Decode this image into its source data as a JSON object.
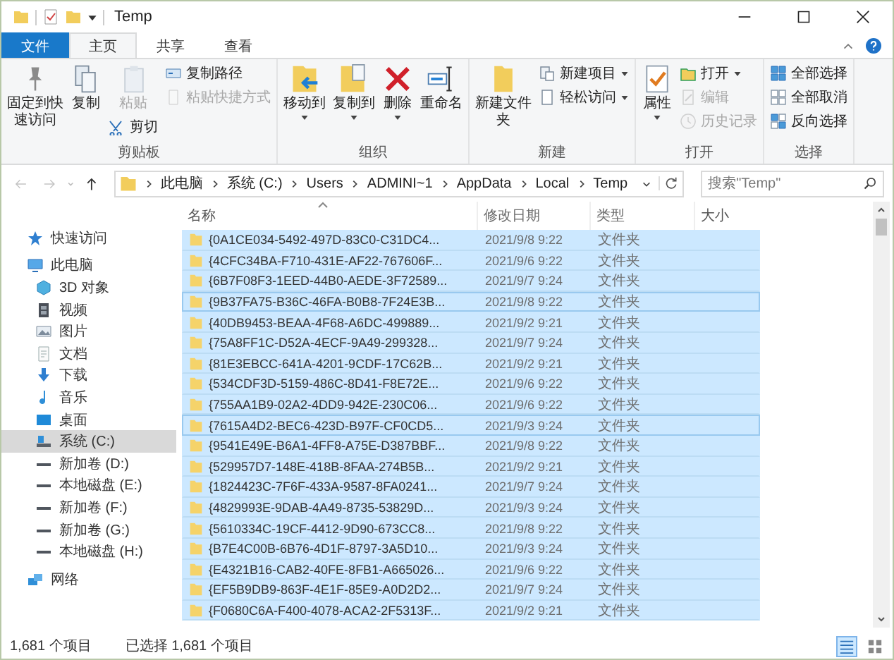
{
  "window": {
    "title": "Temp"
  },
  "tabs": [
    {
      "label": "文件",
      "kind": "file",
      "selected": false
    },
    {
      "label": "主页",
      "kind": "tab",
      "selected": true
    },
    {
      "label": "共享",
      "kind": "tab",
      "selected": false
    },
    {
      "label": "查看",
      "kind": "tab",
      "selected": false
    }
  ],
  "ribbon": {
    "groups": [
      {
        "label": "剪贴板",
        "columns": [
          {
            "items": [
              {
                "label": "固定到快速访问",
                "kind": "large",
                "disabled": false,
                "dropdown": false
              }
            ]
          },
          {
            "items": [
              {
                "label": "复制",
                "kind": "large",
                "disabled": false,
                "dropdown": false
              }
            ]
          },
          {
            "items": [
              {
                "label": "粘贴",
                "kind": "large",
                "disabled": true,
                "dropdown": false
              },
              {
                "label": "剪切",
                "kind": "small",
                "disabled": false,
                "dropdown": false
              }
            ]
          },
          {
            "items": [
              {
                "label": "复制路径",
                "kind": "small",
                "disabled": false,
                "dropdown": false
              },
              {
                "label": "粘贴快捷方式",
                "kind": "small",
                "disabled": true,
                "dropdown": false
              }
            ]
          }
        ]
      },
      {
        "label": "组织",
        "columns": [
          {
            "items": [
              {
                "label": "移动到",
                "kind": "large",
                "disabled": false,
                "dropdown": true
              }
            ]
          },
          {
            "items": [
              {
                "label": "复制到",
                "kind": "large",
                "disabled": false,
                "dropdown": true
              }
            ]
          },
          {
            "items": [
              {
                "label": "删除",
                "kind": "large",
                "disabled": false,
                "dropdown": true
              }
            ]
          },
          {
            "items": [
              {
                "label": "重命名",
                "kind": "large",
                "disabled": false,
                "dropdown": false
              }
            ]
          }
        ]
      },
      {
        "label": "新建",
        "columns": [
          {
            "items": [
              {
                "label": "新建文件夹",
                "kind": "large",
                "disabled": false,
                "dropdown": false
              }
            ]
          },
          {
            "items": [
              {
                "label": "新建项目",
                "kind": "small",
                "disabled": false,
                "dropdown": true
              },
              {
                "label": "轻松访问",
                "kind": "small",
                "disabled": false,
                "dropdown": true
              }
            ]
          }
        ]
      },
      {
        "label": "打开",
        "columns": [
          {
            "items": [
              {
                "label": "属性",
                "kind": "large",
                "disabled": false,
                "dropdown": true
              }
            ]
          },
          {
            "items": [
              {
                "label": "打开",
                "kind": "small",
                "disabled": false,
                "dropdown": true
              },
              {
                "label": "编辑",
                "kind": "small",
                "disabled": true,
                "dropdown": false
              },
              {
                "label": "历史记录",
                "kind": "small",
                "disabled": true,
                "dropdown": false
              }
            ]
          }
        ]
      },
      {
        "label": "选择",
        "columns": [
          {
            "items": [
              {
                "label": "全部选择",
                "kind": "small",
                "disabled": false,
                "dropdown": false
              },
              {
                "label": "全部取消",
                "kind": "small",
                "disabled": false,
                "dropdown": false
              },
              {
                "label": "反向选择",
                "kind": "small",
                "disabled": false,
                "dropdown": false
              }
            ]
          }
        ]
      }
    ]
  },
  "address": {
    "back_disabled": true,
    "forward_disabled": true,
    "crumbs": [
      "此电脑",
      "系统 (C:)",
      "Users",
      "ADMINI~1",
      "AppData",
      "Local",
      "Temp"
    ]
  },
  "search": {
    "placeholder": "搜索\"Temp\""
  },
  "sidebar": {
    "items": [
      {
        "label": "快速访问",
        "kind": "quick",
        "selected": false
      },
      {
        "label": "此电脑",
        "kind": "pc",
        "selected": false,
        "children": [
          {
            "label": "3D 对象",
            "kind": "cube",
            "selected": false
          },
          {
            "label": "视频",
            "kind": "video",
            "selected": false
          },
          {
            "label": "图片",
            "kind": "pictures",
            "selected": false
          },
          {
            "label": "文档",
            "kind": "documents",
            "selected": false
          },
          {
            "label": "下载",
            "kind": "downloads",
            "selected": false
          },
          {
            "label": "音乐",
            "kind": "music",
            "selected": false
          },
          {
            "label": "桌面",
            "kind": "desktop",
            "selected": false
          },
          {
            "label": "系统 (C:)",
            "kind": "system",
            "selected": true
          },
          {
            "label": "新加卷 (D:)",
            "kind": "drive",
            "selected": false
          },
          {
            "label": "本地磁盘 (E:)",
            "kind": "drive",
            "selected": false
          },
          {
            "label": "新加卷 (F:)",
            "kind": "drive",
            "selected": false
          },
          {
            "label": "新加卷 (G:)",
            "kind": "drive",
            "selected": false
          },
          {
            "label": "本地磁盘 (H:)",
            "kind": "drive",
            "selected": false
          }
        ]
      },
      {
        "label": "网络",
        "kind": "network",
        "selected": false
      }
    ]
  },
  "table": {
    "columns": [
      "名称",
      "修改日期",
      "类型",
      "大小"
    ],
    "rows": [
      {
        "name": "{0A1CE034-5492-497D-83C0-C31DC4...",
        "modified": "2021/9/8 9:22",
        "type": "文件夹",
        "selected": true,
        "focused": false
      },
      {
        "name": "{4CFC34BA-F710-431E-AF22-767606F...",
        "modified": "2021/9/6 9:22",
        "type": "文件夹",
        "selected": true,
        "focused": false
      },
      {
        "name": "{6B7F08F3-1EED-44B0-AEDE-3F72589...",
        "modified": "2021/9/7 9:24",
        "type": "文件夹",
        "selected": true,
        "focused": false
      },
      {
        "name": "{9B37FA75-B36C-46FA-B0B8-7F24E3B...",
        "modified": "2021/9/8 9:22",
        "type": "文件夹",
        "selected": true,
        "focused": true
      },
      {
        "name": "{40DB9453-BEAA-4F68-A6DC-499889...",
        "modified": "2021/9/2 9:21",
        "type": "文件夹",
        "selected": true,
        "focused": false
      },
      {
        "name": "{75A8FF1C-D52A-4ECF-9A49-299328...",
        "modified": "2021/9/7 9:24",
        "type": "文件夹",
        "selected": true,
        "focused": false
      },
      {
        "name": "{81E3EBCC-641A-4201-9CDF-17C62B...",
        "modified": "2021/9/2 9:21",
        "type": "文件夹",
        "selected": true,
        "focused": false
      },
      {
        "name": "{534CDF3D-5159-486C-8D41-F8E72E...",
        "modified": "2021/9/6 9:22",
        "type": "文件夹",
        "selected": true,
        "focused": false
      },
      {
        "name": "{755AA1B9-02A2-4DD9-942E-230C06...",
        "modified": "2021/9/6 9:22",
        "type": "文件夹",
        "selected": true,
        "focused": false
      },
      {
        "name": "{7615A4D2-BEC6-423D-B97F-CF0CD5...",
        "modified": "2021/9/3 9:24",
        "type": "文件夹",
        "selected": true,
        "focused": true
      },
      {
        "name": "{9541E49E-B6A1-4FF8-A75E-D387BBF...",
        "modified": "2021/9/8 9:22",
        "type": "文件夹",
        "selected": true,
        "focused": false
      },
      {
        "name": "{529957D7-148E-418B-8FAA-274B5B...",
        "modified": "2021/9/2 9:21",
        "type": "文件夹",
        "selected": true,
        "focused": false
      },
      {
        "name": "{1824423C-7F6F-433A-9587-8FA0241...",
        "modified": "2021/9/7 9:24",
        "type": "文件夹",
        "selected": true,
        "focused": false
      },
      {
        "name": "{4829993E-9DAB-4A49-8735-53829D...",
        "modified": "2021/9/3 9:24",
        "type": "文件夹",
        "selected": true,
        "focused": false
      },
      {
        "name": "{5610334C-19CF-4412-9D90-673CC8...",
        "modified": "2021/9/8 9:22",
        "type": "文件夹",
        "selected": true,
        "focused": false
      },
      {
        "name": "{B7E4C00B-6B76-4D1F-8797-3A5D10...",
        "modified": "2021/9/3 9:24",
        "type": "文件夹",
        "selected": true,
        "focused": false
      },
      {
        "name": "{E4321B16-CAB2-40FE-8FB1-A665026...",
        "modified": "2021/9/6 9:22",
        "type": "文件夹",
        "selected": true,
        "focused": false
      },
      {
        "name": "{EF5B9DB9-863F-4E1F-85E9-A0D2D2...",
        "modified": "2021/9/7 9:24",
        "type": "文件夹",
        "selected": true,
        "focused": false
      },
      {
        "name": "{F0680C6A-F400-4078-ACA2-2F5313F...",
        "modified": "2021/9/2 9:21",
        "type": "文件夹",
        "selected": true,
        "focused": false
      }
    ]
  },
  "status_bar": {
    "count": "1,681 个项目",
    "selection": "已选择 1,681 个项目"
  }
}
